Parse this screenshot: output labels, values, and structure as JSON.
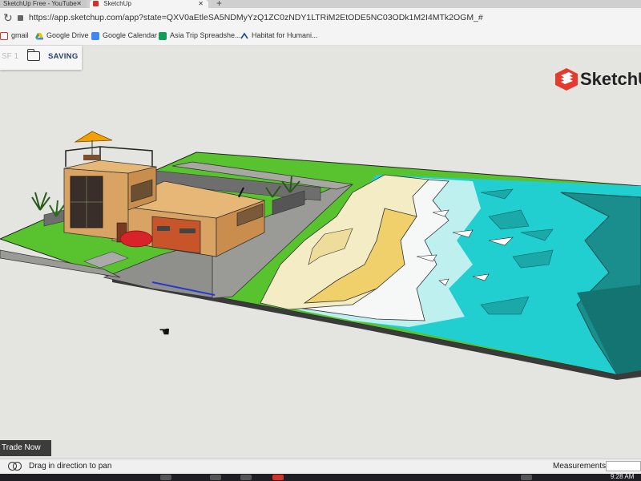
{
  "browser": {
    "tabs": [
      {
        "label": "SketchUp Free - YouTube"
      },
      {
        "label": "SketchUp"
      }
    ],
    "url": "https://app.sketchup.com/app?state=QXV0aEtleSA5NDMyYzQ1ZC0zNDY1LTRiM2EtODE5NC03ODk1M2I4MTk2OGM_#",
    "bookmarks": [
      {
        "label": "gmail",
        "icon": "gmail-icon"
      },
      {
        "label": "Google Drive",
        "icon": "google-drive-icon"
      },
      {
        "label": "Google Calendar",
        "icon": "google-calendar-icon"
      },
      {
        "label": "Asia Trip Spreadshe...",
        "icon": "google-sheets-icon"
      },
      {
        "label": "Habitat for Humani...",
        "icon": "habitat-icon"
      }
    ]
  },
  "app": {
    "file_fragment": "SF 1",
    "save_status": "SAVING",
    "brand": "SketchUp",
    "trade_button": "Trade Now",
    "status_text": "Drag in direction to pan",
    "measurements_label": "Measurements",
    "measurements_value": ""
  },
  "taskbar": {
    "time": "9:28 AM"
  },
  "colors": {
    "brand_red": "#e33b2e",
    "saving_text": "#2a3f6b",
    "grass": "#59c22f",
    "sand": "#f0dfa8",
    "ocean": "#22cfd0",
    "deep_ocean": "#1a8e8c"
  }
}
